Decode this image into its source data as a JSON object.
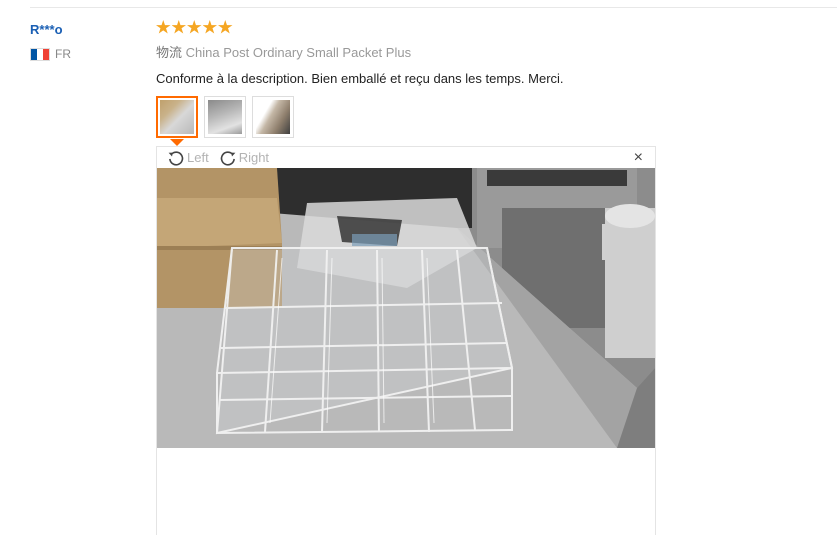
{
  "buyer": {
    "name": "R***o",
    "country_code": "FR",
    "flag_colors": [
      "#0055a4",
      "#ffffff",
      "#ef4135"
    ]
  },
  "review": {
    "rating": 5,
    "star_color": "#f5a623",
    "shipping_label": "物流",
    "shipping_method": "China Post Ordinary Small Packet Plus",
    "text": "Conforme à la description. Bien emballé et reçu dans les temps. Merci."
  },
  "thumbnails": [
    {
      "name": "review-photo-1",
      "active": true
    },
    {
      "name": "review-photo-2",
      "active": false
    },
    {
      "name": "review-photo-3",
      "active": false
    }
  ],
  "viewer": {
    "rotate_left_label": "Left",
    "rotate_right_label": "Right",
    "close_glyph": "×",
    "accent_color": "#ff6a00"
  }
}
